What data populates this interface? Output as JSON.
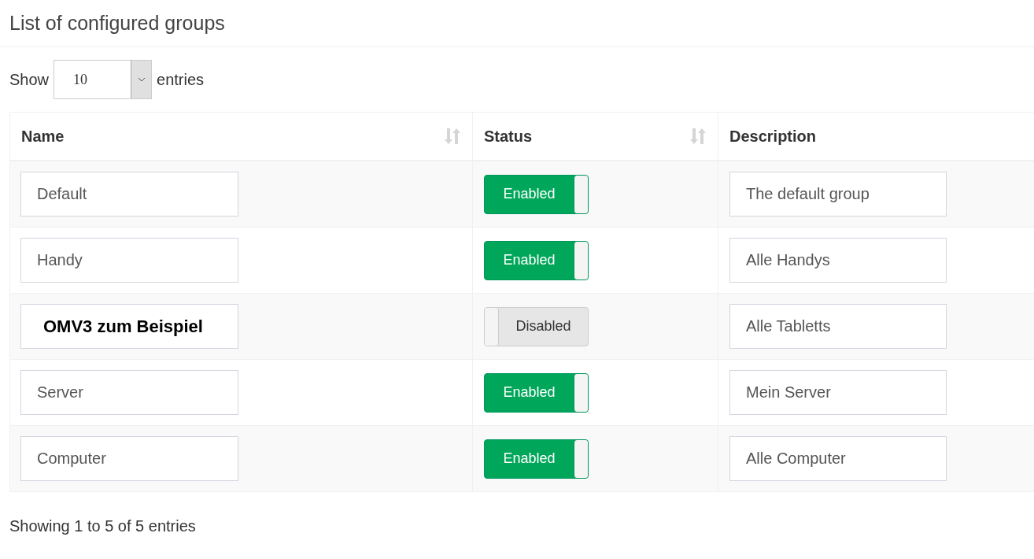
{
  "title": "List of configured groups",
  "length_menu": {
    "prefix": "Show",
    "value": "10",
    "suffix": "entries"
  },
  "table": {
    "columns": [
      {
        "label": "Name",
        "sortable": true
      },
      {
        "label": "Status",
        "sortable": true
      },
      {
        "label": "Description",
        "sortable": false
      }
    ],
    "rows": [
      {
        "name": "Default",
        "on": true,
        "status": "Enabled",
        "description": "The default group"
      },
      {
        "name": "Handy",
        "on": true,
        "status": "Enabled",
        "description": "Alle Handys"
      },
      {
        "overlay": "OMV3 zum Beispiel",
        "on": false,
        "status": "Disabled",
        "description": "Alle Tabletts"
      },
      {
        "name": "Server",
        "on": true,
        "status": "Enabled",
        "description": "Mein Server"
      },
      {
        "name": "Computer",
        "on": true,
        "status": "Enabled",
        "description": "Alle Computer"
      }
    ]
  },
  "info": "Showing 1 to 5 of 5 entries"
}
